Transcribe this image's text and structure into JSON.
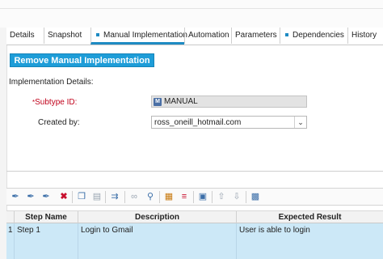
{
  "tabs": [
    {
      "label": "Details",
      "active": false,
      "dot": false
    },
    {
      "label": "Snapshot",
      "active": false,
      "dot": false
    },
    {
      "label": "Manual Implementation",
      "active": true,
      "dot": true
    },
    {
      "label": "Automation",
      "active": false,
      "dot": false
    },
    {
      "label": "Parameters",
      "active": false,
      "dot": false
    },
    {
      "label": "Dependencies",
      "active": false,
      "dot": true
    },
    {
      "label": "History",
      "active": false,
      "dot": false
    }
  ],
  "remove_button": "Remove Manual Implementation",
  "implementation_details": "Implementation Details:",
  "subtype": {
    "label": "Subtype ID:",
    "required_mark": "*",
    "value": "MANUAL",
    "icon": "M"
  },
  "created_by": {
    "label": "Created by:",
    "value": "ross_oneill_hotmail.com"
  },
  "toolbar_icons": [
    "new-step-icon",
    "new-step-after-icon",
    "renumber-steps-icon",
    "delete-icon",
    "copy-icon",
    "paste-icon",
    "call-test-icon",
    "link-icon",
    "find-icon",
    "insert-parameter-icon",
    "generate-script-icon",
    "save-icon",
    "move-up-icon",
    "move-down-icon",
    "expand-view-icon"
  ],
  "grid": {
    "columns": [
      "Step Name",
      "Description",
      "Expected Result"
    ],
    "rows": [
      {
        "num": "1",
        "step": "Step 1",
        "description": "Login to Gmail",
        "expected": "User is able to login"
      }
    ]
  },
  "colors": {
    "accent": "#1e8bc3",
    "button": "#1e9dd8",
    "required": "#c0001a",
    "row_selected": "#cce8f7"
  }
}
